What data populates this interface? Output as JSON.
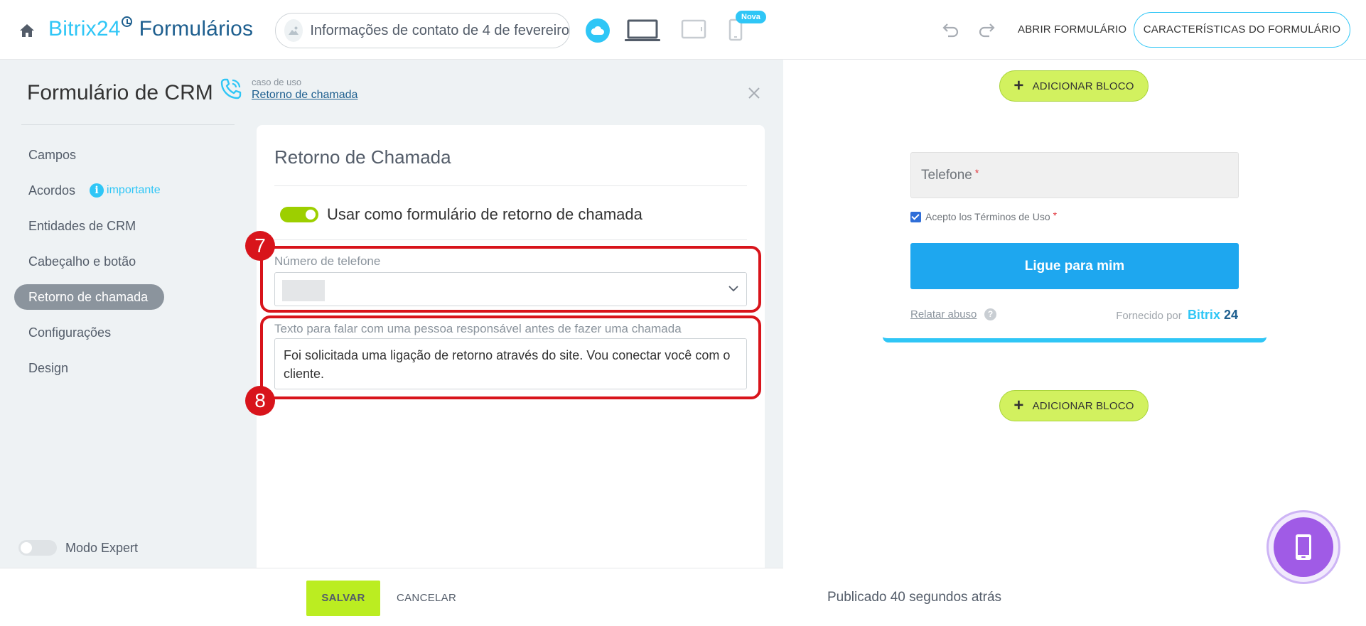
{
  "header": {
    "brand_part1": "Bitrix24",
    "brand_part2": "Formulários",
    "form_name": "Informações de contato de 4 de fevereiro",
    "badge_new": "Nova",
    "open_form": "ABRIR FORMULÁRIO",
    "form_features": "CARACTERÍSTICAS DO FORMULÁRIO"
  },
  "panel": {
    "title": "Formulário de CRM",
    "use_case_label": "caso de uso",
    "use_case_link": "Retorno de chamada"
  },
  "sidebar": {
    "items": [
      {
        "label": "Campos"
      },
      {
        "label": "Acordos",
        "hint": "importante"
      },
      {
        "label": "Entidades de CRM"
      },
      {
        "label": "Cabeçalho e botão"
      },
      {
        "label": "Retorno de chamada",
        "active": true
      },
      {
        "label": "Configurações"
      },
      {
        "label": "Design"
      }
    ],
    "expert_mode": "Modo Expert"
  },
  "card": {
    "title": "Retorno de Chamada",
    "toggle_label": "Usar como formulário de retorno de chamada",
    "phone_label": "Número de telefone",
    "text_label": "Texto para falar com uma pessoa responsável antes de fazer uma chamada",
    "text_value": "Foi solicitada uma ligação de retorno através do site. Vou conectar você com o cliente.",
    "step7": "7",
    "step8": "8"
  },
  "footer": {
    "save": "SALVAR",
    "cancel": "CANCELAR"
  },
  "preview": {
    "add_block": "ADICIONAR BLOCO",
    "phone_placeholder": "Telefone",
    "required_mark": "*",
    "terms": "Acepto los Términos de Uso",
    "call_button": "Ligue para mim",
    "report_abuse": "Relatar abuso",
    "help_mark": "?",
    "powered_by": "Fornecido por",
    "logo_a": "Bitrix",
    "logo_b": "24",
    "published": "Publicado 40 segundos atrás"
  },
  "colors": {
    "accent": "#2fc6f6",
    "brand_dark": "#1e5f8f",
    "toggle_on": "#9dcf00",
    "save_button": "#bbed21",
    "highlight": "#d8141b",
    "call_button": "#1ea7ef",
    "mobile_button": "#a05be6"
  }
}
